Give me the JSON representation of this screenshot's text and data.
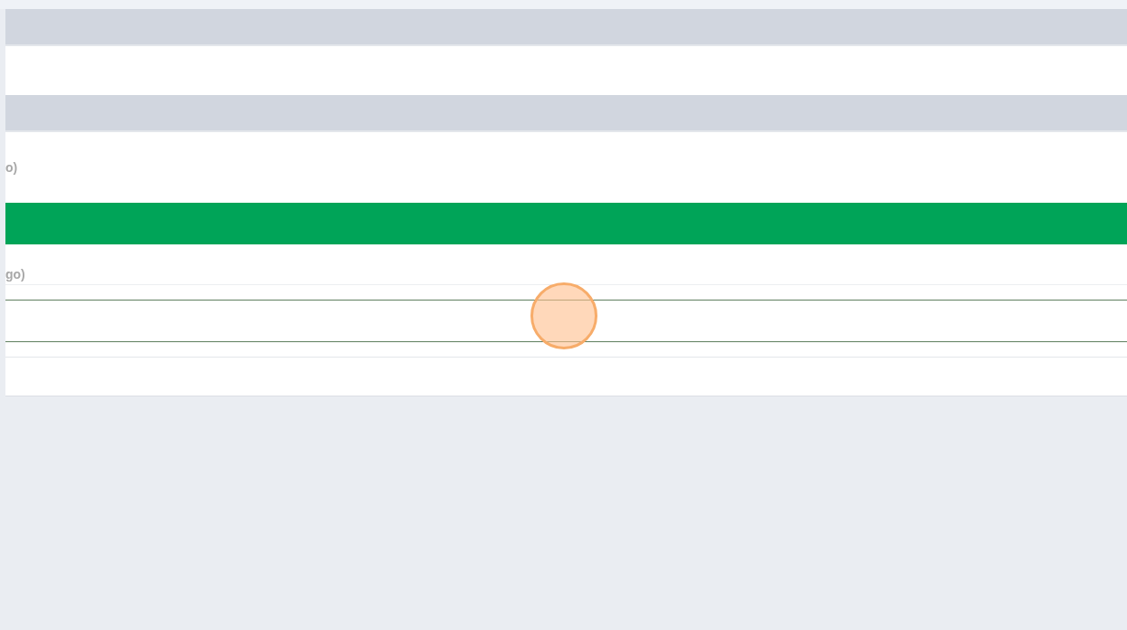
{
  "rows": [
    {
      "kind": "header"
    },
    {
      "kind": "blank"
    },
    {
      "kind": "header"
    },
    {
      "kind": "text",
      "text": "o)"
    },
    {
      "kind": "highlight"
    },
    {
      "kind": "text",
      "text": "go)"
    },
    {
      "kind": "input"
    },
    {
      "kind": "blank"
    }
  ]
}
